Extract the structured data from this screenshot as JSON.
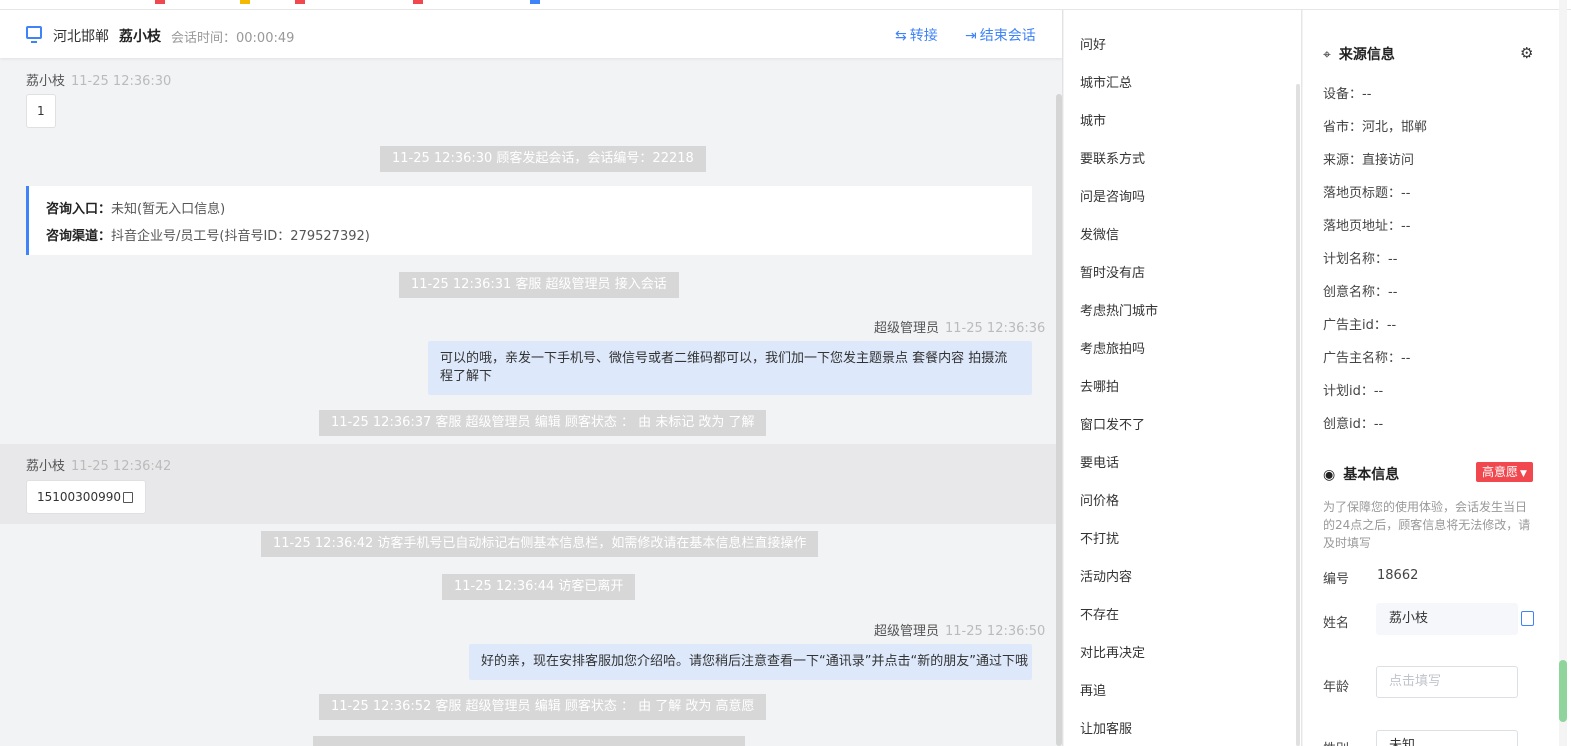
{
  "header": {
    "region": "河北邯郸",
    "customer_name": "荔小枝",
    "session_time": "会话时间：00:00:49",
    "transfer_label": "转接",
    "end_label": "结束会话"
  },
  "chat": {
    "msg1": {
      "sender": "荔小枝",
      "time": "11-25 12:36:30",
      "text": "1"
    },
    "sys1": "11-25 12:36:30 顾客发起会话，会话编号：22218",
    "entry": {
      "label1": "咨询入口：",
      "value1": "未知(暂无入口信息)",
      "label2": "咨询渠道：",
      "value2": "抖音企业号/员工号(抖音号ID：279527392)"
    },
    "sys2": "11-25 12:36:31 客服 超级管理员 接入会话",
    "msg2": {
      "sender": "超级管理员",
      "time": "11-25 12:36:36",
      "text": "可以的哦，亲发一下手机号、微信号或者二维码都可以，我们加一下您发主题景点 套餐内容 拍摄流程了解下"
    },
    "sys3": "11-25 12:36:37 客服 超级管理员 编辑 顾客状态 ： 由 未标记 改为 了解",
    "msg3": {
      "sender": "荔小枝",
      "time": "11-25 12:36:42",
      "text": "15100300990"
    },
    "sys4": "11-25 12:36:42 访客手机号已自动标记右侧基本信息栏，如需修改请在基本信息栏直接操作",
    "sys5": "11-25 12:36:44 访客已离开",
    "msg4": {
      "sender": "超级管理员",
      "time": "11-25 12:36:50",
      "text": "好的亲，现在安排客服加您介绍哈。请您稍后注意查看一下“通讯录”并点击“新的朋友”通过下哦"
    },
    "sys6": "11-25 12:36:52 客服 超级管理员 编辑 顾客状态 ： 由 了解 改为 高意愿"
  },
  "quick_replies": [
    "问好",
    "城市汇总",
    "城市",
    "要联系方式",
    "问是咨询吗",
    "发微信",
    "暂时没有店",
    "考虑热门城市",
    "考虑旅拍吗",
    "去哪拍",
    "窗口发不了",
    "要电话",
    "问价格",
    "不打扰",
    "活动内容",
    "不存在",
    "对比再决定",
    "再追",
    "让加客服"
  ],
  "source_info": {
    "title": "来源信息",
    "rows": [
      "设备：--",
      "省市：河北，邯郸",
      "来源：直接访问",
      "落地页标题：--",
      "落地页地址：--",
      "计划名称：--",
      "创意名称：--",
      "广告主id：--",
      "广告主名称：--",
      "计划id：--",
      "创意id：--"
    ]
  },
  "basic_info": {
    "title": "基本信息",
    "intent_tag": "高意愿",
    "notice": "为了保障您的使用体验，会话发生当日的24点之后，顾客信息将无法修改，请及时填写",
    "id_label": "编号",
    "id_value": "18662",
    "name_label": "姓名",
    "name_value": "荔小枝",
    "age_label": "年龄",
    "age_placeholder": "点击填写",
    "gender_label": "性别",
    "gender_value": "未知"
  },
  "colors": {
    "accent": "#3f83f8",
    "intent_red": "#f0484e",
    "out_bubble": "#dde8fb",
    "system_gray": "#d7d7d7"
  }
}
